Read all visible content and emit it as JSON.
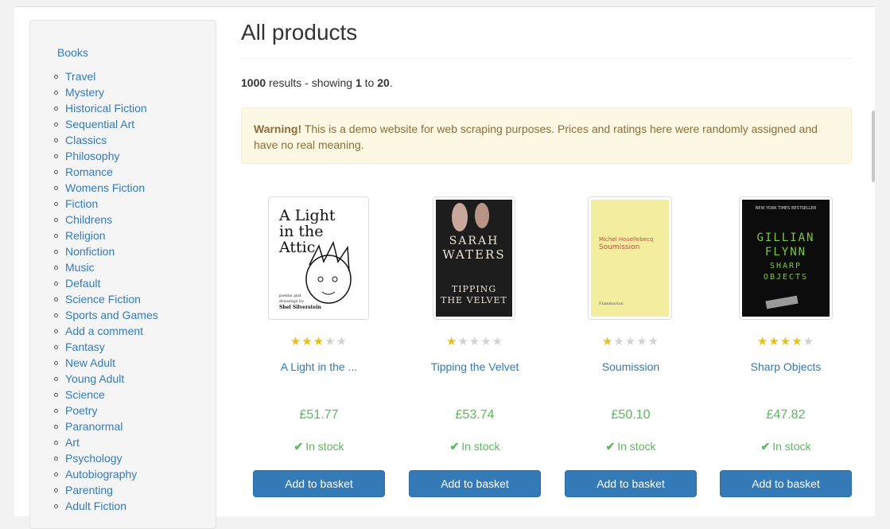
{
  "sidebar": {
    "root_label": "Books",
    "categories": [
      "Travel",
      "Mystery",
      "Historical Fiction",
      "Sequential Art",
      "Classics",
      "Philosophy",
      "Romance",
      "Womens Fiction",
      "Fiction",
      "Childrens",
      "Religion",
      "Nonfiction",
      "Music",
      "Default",
      "Science Fiction",
      "Sports and Games",
      "Add a comment",
      "Fantasy",
      "New Adult",
      "Young Adult",
      "Science",
      "Poetry",
      "Paranormal",
      "Art",
      "Psychology",
      "Autobiography",
      "Parenting",
      "Adult Fiction"
    ]
  },
  "main": {
    "title": "All products",
    "results": {
      "total": "1000",
      "text_results": "results - showing",
      "from": "1",
      "to_word": "to",
      "to": "20",
      "end": "."
    },
    "alert": {
      "strong": "Warning!",
      "text": "This is a demo website for web scraping purposes. Prices and ratings here were randomly assigned and have no real meaning."
    }
  },
  "products": [
    {
      "title": "A Light in the ...",
      "rating": 3,
      "price": "£51.77",
      "stock": "In stock",
      "button": "Add to basket",
      "cover": {
        "bg": "#ffffff",
        "lines": [
          "A Light",
          "in the",
          "Attic"
        ],
        "small": [
          "poems and",
          "drawings by",
          "Shel Silverstein"
        ]
      }
    },
    {
      "title": "Tipping the Velvet",
      "rating": 1,
      "price": "£53.74",
      "stock": "In stock",
      "button": "Add to basket",
      "cover": {
        "bg": "#1d1d1d",
        "lines": [
          "SARAH",
          "WATERS",
          "TIPPING",
          "THE VELVET"
        ]
      }
    },
    {
      "title": "Soumission",
      "rating": 1,
      "price": "£50.10",
      "stock": "In stock",
      "button": "Add to basket",
      "cover": {
        "bg": "#f3eda0",
        "lines": [
          "Michel Houellebecq",
          "Soumission",
          "Flammarion"
        ]
      }
    },
    {
      "title": "Sharp Objects",
      "rating": 4,
      "price": "£47.82",
      "stock": "In stock",
      "button": "Add to basket",
      "cover": {
        "bg": "#0c0c0c",
        "lines": [
          "GILLIAN",
          "FLYNN",
          "SHARP",
          "OBJECTS"
        ],
        "small": [
          "NEW YORK TIMES BESTSELLER"
        ]
      }
    }
  ],
  "colors": {
    "link": "#337ab7",
    "price": "#5cb85c",
    "star_on": "#e7c11a",
    "star_off": "#d3d3d3",
    "button": "#337ab7",
    "alert_bg": "#fcf8e3"
  },
  "icons": {
    "stock": "check-icon",
    "rating": "star-icon"
  }
}
